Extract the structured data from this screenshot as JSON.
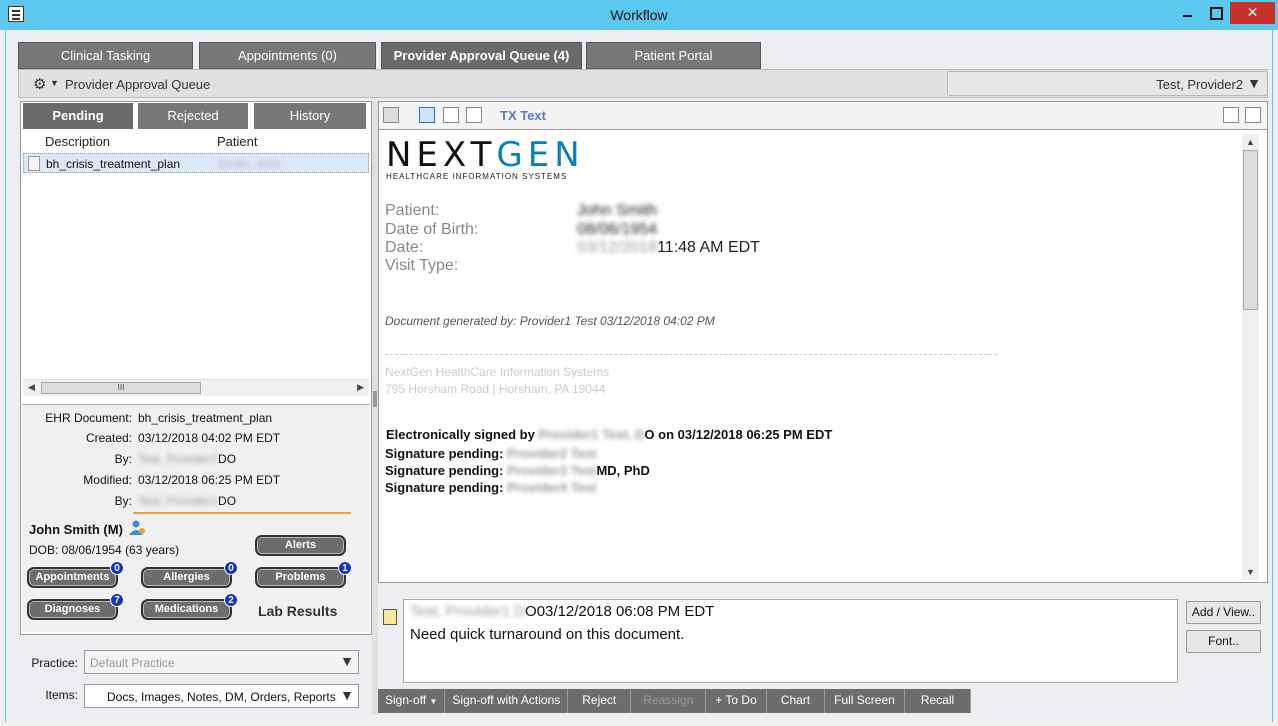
{
  "window": {
    "title": "Workflow"
  },
  "top_tabs": [
    {
      "label": "Clinical Tasking"
    },
    {
      "label": "Appointments (0)"
    },
    {
      "label": "Provider Approval Queue (4)"
    },
    {
      "label": "Patient Portal"
    }
  ],
  "breadcrumb": {
    "title": "Provider Approval Queue",
    "user": "Test, Provider2"
  },
  "sub_tabs": [
    {
      "label": "Pending"
    },
    {
      "label": "Rejected"
    },
    {
      "label": "History"
    }
  ],
  "list": {
    "columns": [
      "Description",
      "Patient"
    ],
    "rows": [
      {
        "description": "bh_crisis_treatment_plan",
        "patient": "Smith, John"
      }
    ]
  },
  "details": {
    "ehr_label": "EHR Document:",
    "ehr_value": "bh_crisis_treatment_plan",
    "created_label": "Created:",
    "created_value": "03/12/2018 04:02 PM EDT",
    "by_label": "By:",
    "created_by_hidden": "Test, Provider1",
    "created_by_suffix": "DO",
    "modified_label": "Modified:",
    "modified_value": "03/12/2018 06:25 PM EDT",
    "modified_by_hidden": "Test, Provider1",
    "modified_by_suffix": "DO"
  },
  "patient": {
    "name": "John Smith",
    "sex": "(M)",
    "dob": "DOB: 08/06/1954 (63 years)"
  },
  "chart_buttons": {
    "alerts": "Alerts",
    "appointments": "Appointments",
    "appointments_count": "0",
    "allergies": "Allergies",
    "allergies_count": "0",
    "problems": "Problems",
    "problems_count": "1",
    "diagnoses": "Diagnoses",
    "diagnoses_count": "7",
    "medications": "Medications",
    "medications_count": "2",
    "lab_results": "Lab Results"
  },
  "filters": {
    "practice_label": "Practice:",
    "practice_value": "Default Practice",
    "items_label": "Items:",
    "items_value": "Docs, Images, Notes, DM, Orders, Reports, H"
  },
  "toolbar": {
    "tx_text": "TX Text"
  },
  "document": {
    "logo_next": "NEXT",
    "logo_gen": "GEN",
    "logo_sub": "HEALTHCARE INFORMATION SYSTEMS",
    "patient_label": "Patient:",
    "patient_value": "John Smith",
    "dob_label": "Date of Birth:",
    "dob_value": "08/06/1954",
    "date_label": "Date:",
    "date_hidden": "03/12/2018",
    "date_time": "11:48 AM EDT",
    "visit_label": "Visit Type:",
    "generated": "Document generated by: Provider1 Test  03/12/2018 04:02 PM",
    "addr_line1": "NextGen HealthCare Information Systems",
    "addr_line2": "795 Horsham Road | Horsham, PA 19044",
    "esign_prefix": "Electronically signed by",
    "esign_hidden": "Provider1 Test, D",
    "esign_suffix": "O on 03/12/2018   06:25 PM EDT",
    "sig_label": "Signature pending:",
    "sig1_hidden": "Provider2 Test",
    "sig2_hidden": "Provider3 Test",
    "sig2_suffix": "MD, PhD",
    "sig3_hidden": "Provider4 Test"
  },
  "note": {
    "author_hidden": "Test, Provider1 D",
    "author_suffix": "O",
    "timestamp": "03/12/2018 06:08 PM EDT",
    "text": "Need quick turnaround on this document."
  },
  "side_buttons": {
    "add_view": "Add / View..",
    "font": "Font.."
  },
  "actions": [
    "Sign-off",
    "Sign-off with Actions",
    "Reject",
    "Reassign",
    "+ To Do",
    "Chart",
    "Full Screen",
    "Recall"
  ]
}
